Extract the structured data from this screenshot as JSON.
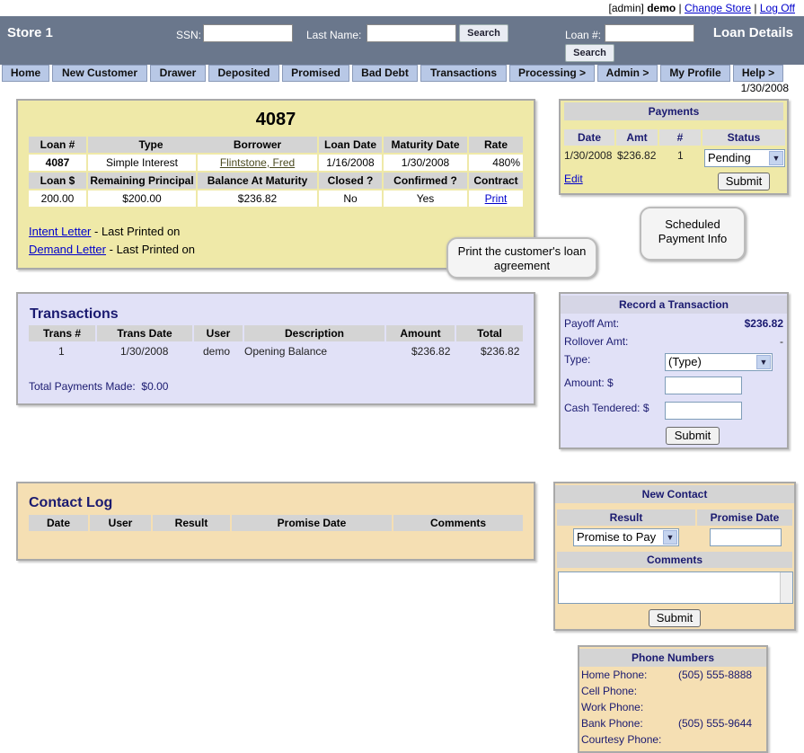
{
  "util": {
    "role": "[admin]",
    "user": "demo",
    "change_store": "Change Store",
    "logoff": "Log Off"
  },
  "header": {
    "store": "Store 1",
    "title": "Loan Details",
    "ssn_label": "SSN:",
    "lastname_label": "Last Name:",
    "loan_label": "Loan #:",
    "search_btn1": "Search",
    "search_btn2": "Search"
  },
  "nav": [
    "Home",
    "New Customer",
    "Drawer",
    "Deposited",
    "Promised",
    "Bad Debt",
    "Transactions",
    "Processing >",
    "Admin >",
    "My Profile",
    "Help >"
  ],
  "current_date": "1/30/2008",
  "loan": {
    "number": "4087",
    "h1": [
      "Loan #",
      "Type",
      "Borrower",
      "Loan Date",
      "Maturity Date",
      "Rate"
    ],
    "r1": [
      "4087",
      "Simple Interest",
      "Flintstone, Fred",
      "1/16/2008",
      "1/30/2008",
      "480%"
    ],
    "h2": [
      "Loan $",
      "Remaining Principal",
      "Balance At Maturity",
      "Closed ?",
      "Confirmed ?",
      "Contract"
    ],
    "r2": [
      "200.00",
      "$200.00",
      "$236.82",
      "No",
      "Yes",
      "Print"
    ],
    "intent_link": "Intent Letter",
    "intent_text": "- Last Printed on",
    "demand_link": "Demand Letter",
    "demand_text": "- Last Printed on"
  },
  "payments": {
    "title": "Payments",
    "headers": [
      "Date",
      "Amt",
      "#",
      "Status"
    ],
    "row": [
      "1/30/2008",
      "$236.82",
      "1"
    ],
    "status": "Pending",
    "edit": "Edit",
    "submit": "Submit"
  },
  "callouts": {
    "print": "Print the customer's loan agreement",
    "scheduled": "Scheduled Payment Info"
  },
  "transactions": {
    "title": "Transactions",
    "headers": [
      "Trans #",
      "Trans Date",
      "User",
      "Description",
      "Amount",
      "Total"
    ],
    "row": [
      "1",
      "1/30/2008",
      "demo",
      "Opening Balance",
      "$236.82",
      "$236.82"
    ],
    "total_label": "Total Payments Made:",
    "total_value": "$0.00"
  },
  "record": {
    "title": "Record a Transaction",
    "payoff_label": "Payoff Amt:",
    "payoff_value": "$236.82",
    "rollover_label": "Rollover Amt:",
    "rollover_value": "-",
    "type_label": "Type:",
    "type_value": "(Type)",
    "amount_label": "Amount: $",
    "cash_label": "Cash Tendered: $",
    "submit": "Submit"
  },
  "contact_log": {
    "title": "Contact Log",
    "headers": [
      "Date",
      "User",
      "Result",
      "Promise Date",
      "Comments"
    ]
  },
  "new_contact": {
    "title": "New Contact",
    "result_label": "Result",
    "promise_label": "Promise Date",
    "result_value": "Promise to Pay",
    "comments_label": "Comments",
    "submit": "Submit"
  },
  "phones": {
    "title": "Phone Numbers",
    "home_label": "Home Phone:",
    "home": "(505) 555-8888",
    "cell_label": "Cell Phone:",
    "work_label": "Work Phone:",
    "bank_label": "Bank Phone:",
    "bank": "(505) 555-9644",
    "courtesy_label": "Courtesy Phone:"
  },
  "colors": {
    "header": "#6a778c",
    "nav": "#b8c8e6",
    "loan_panel": "#efe9a8",
    "trans_panel": "#e1e1f7",
    "contact_panel": "#f5dfb3"
  }
}
